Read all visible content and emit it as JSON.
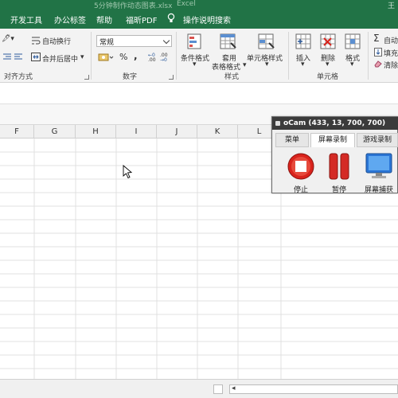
{
  "window": {
    "filename": "5分钟制作动态图表.xlsx",
    "app": "Excel",
    "account": "王"
  },
  "tabs": [
    "开发工具",
    "办公标签",
    "帮助",
    "福昕PDF",
    "操作说明搜索"
  ],
  "ribbon": {
    "alignment": {
      "orient": "🖋▾",
      "wrap_text": "自动换行",
      "merge_center": "合并后居中",
      "group": "对齐方式"
    },
    "number": {
      "format_value": "常规",
      "percent": "%",
      "comma": ",",
      "group": "数字"
    },
    "styles": {
      "conditional": "条件格式",
      "table_format_1": "套用",
      "table_format_2": "表格格式",
      "cell_styles": "单元格样式",
      "group": "样式"
    },
    "cells": {
      "insert": "插入",
      "delete": "删除",
      "format": "格式",
      "group": "单元格"
    },
    "editing": {
      "autosum": "自动",
      "fill": "填充",
      "clear": "清除"
    }
  },
  "columns": [
    "F",
    "G",
    "H",
    "I",
    "J",
    "K",
    "L"
  ],
  "ocam": {
    "title": "oCam (433, 13, 700, 700)",
    "tabs": [
      "菜单",
      "屏幕录制",
      "游戏录制"
    ],
    "buttons": {
      "stop": "停止",
      "pause": "暂停",
      "capture": "屏幕捕获"
    }
  },
  "colors": {
    "excel_green": "#217346",
    "stop_red": "#d9231c",
    "pause_red": "#d42a25"
  }
}
